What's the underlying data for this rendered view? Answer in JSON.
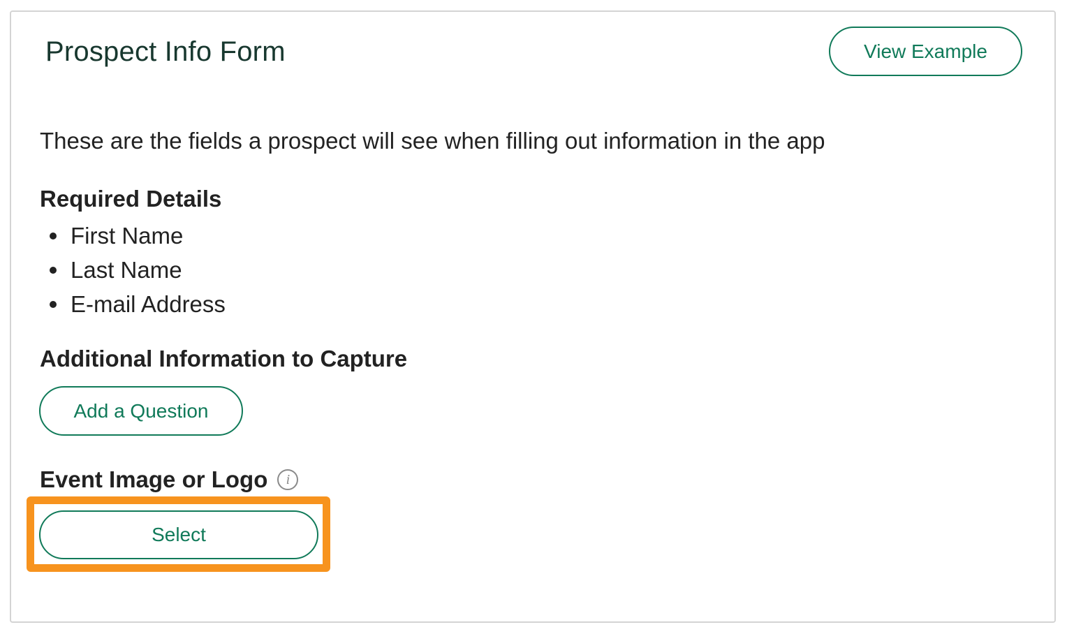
{
  "form": {
    "title": "Prospect Info Form",
    "view_example_label": "View Example",
    "description": "These are the fields a prospect will see when filling out information in the app"
  },
  "required_details": {
    "heading": "Required Details",
    "items": [
      "First Name",
      "Last Name",
      "E-mail Address"
    ]
  },
  "additional_info": {
    "heading": "Additional Information to Capture",
    "add_question_label": "Add a Question"
  },
  "event_image": {
    "heading": "Event Image or Logo",
    "info_icon": "info-icon",
    "info_glyph": "i",
    "select_label": "Select"
  },
  "colors": {
    "accent": "#107a59",
    "title": "#18382f",
    "highlight": "#f7931e",
    "border": "#d4d4d4"
  }
}
